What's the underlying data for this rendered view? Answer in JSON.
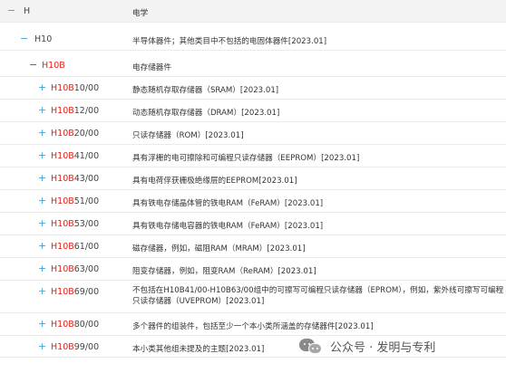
{
  "colors": {
    "accent_red": "#e2231a",
    "expand_blue": "#3aa0d8",
    "header_bg": "#f3f3f3"
  },
  "tree": {
    "section": {
      "toggle": "−",
      "code": "H",
      "desc": "电学"
    },
    "class": {
      "toggle": "−",
      "code": "H10",
      "desc": "半导体器件；其他类目中不包括的电固体器件[2023.01]"
    },
    "subclass": {
      "toggle": "−",
      "code": "H10B",
      "desc": "电存储器件"
    },
    "groups": [
      {
        "toggle": "+",
        "prefix": "H10B",
        "suffix": "10/00",
        "desc": "静态随机存取存储器（SRAM）[2023.01]"
      },
      {
        "toggle": "+",
        "prefix": "H10B",
        "suffix": "12/00",
        "desc": "动态随机存取存储器（DRAM）[2023.01]"
      },
      {
        "toggle": "+",
        "prefix": "H10B",
        "suffix": "20/00",
        "desc": "只读存储器（ROM）[2023.01]"
      },
      {
        "toggle": "+",
        "prefix": "H10B",
        "suffix": "41/00",
        "desc": "具有浮栅的电可擦除和可编程只读存储器（EEPROM）[2023.01]"
      },
      {
        "toggle": "+",
        "prefix": "H10B",
        "suffix": "43/00",
        "desc": "具有电荷俘获栅极绝缘层的EEPROM[2023.01]"
      },
      {
        "toggle": "+",
        "prefix": "H10B",
        "suffix": "51/00",
        "desc": "具有铁电存储晶体管的铁电RAM（FeRAM）[2023.01]"
      },
      {
        "toggle": "+",
        "prefix": "H10B",
        "suffix": "53/00",
        "desc": "具有铁电存储电容器的铁电RAM（FeRAM）[2023.01]"
      },
      {
        "toggle": "+",
        "prefix": "H10B",
        "suffix": "61/00",
        "desc": "磁存储器，例如，磁阻RAM（MRAM）[2023.01]"
      },
      {
        "toggle": "+",
        "prefix": "H10B",
        "suffix": "63/00",
        "desc": "阻变存储器，例如，阻变RAM（ReRAM）[2023.01]"
      },
      {
        "toggle": "+",
        "prefix": "H10B",
        "suffix": "69/00",
        "desc": "不包括在H10B41/00-H10B63/00组中的可擦写可编程只读存储器（EPROM），例如，紫外线可擦写可编程只读存储器（UVEPROM）[2023.01]"
      },
      {
        "toggle": "+",
        "prefix": "H10B",
        "suffix": "80/00",
        "desc": "多个器件的组装件，包括至少一个本小类所涵盖的存储器件[2023.01]"
      },
      {
        "toggle": "+",
        "prefix": "H10B",
        "suffix": "99/00",
        "desc": "本小类其他组未提及的主题[2023.01]"
      }
    ]
  },
  "watermark": {
    "icon": "wechat-icon",
    "text": "公众号 · 发明与专利"
  }
}
